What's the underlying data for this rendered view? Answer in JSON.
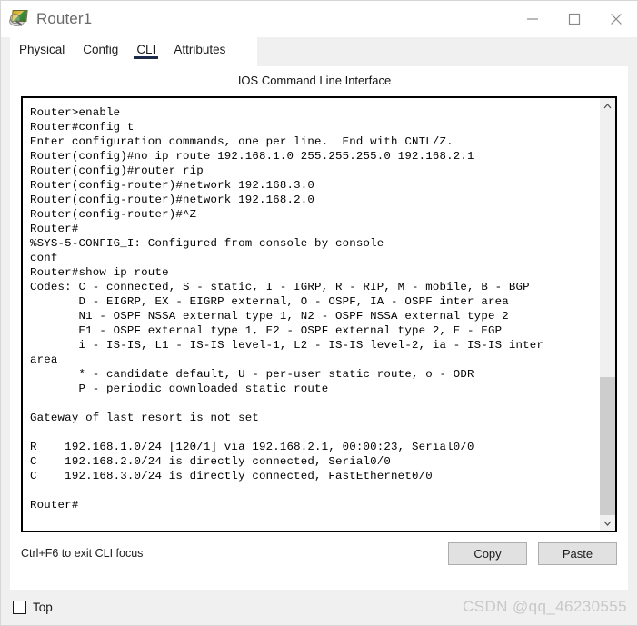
{
  "window": {
    "title": "Router1",
    "icon": "packet-tracer-router-icon",
    "controls": {
      "minimize": "minimize-icon",
      "maximize": "maximize-icon",
      "close": "close-icon"
    }
  },
  "tabs": [
    {
      "label": "Physical",
      "active": false
    },
    {
      "label": "Config",
      "active": false
    },
    {
      "label": "CLI",
      "active": true
    },
    {
      "label": "Attributes",
      "active": false
    }
  ],
  "panel": {
    "heading": "IOS Command Line Interface"
  },
  "console": {
    "text": "Router>enable\nRouter#config t\nEnter configuration commands, one per line.  End with CNTL/Z.\nRouter(config)#no ip route 192.168.1.0 255.255.255.0 192.168.2.1\nRouter(config)#router rip\nRouter(config-router)#network 192.168.3.0\nRouter(config-router)#network 192.168.2.0\nRouter(config-router)#^Z\nRouter#\n%SYS-5-CONFIG_I: Configured from console by console\nconf\nRouter#show ip route\nCodes: C - connected, S - static, I - IGRP, R - RIP, M - mobile, B - BGP\n       D - EIGRP, EX - EIGRP external, O - OSPF, IA - OSPF inter area\n       N1 - OSPF NSSA external type 1, N2 - OSPF NSSA external type 2\n       E1 - OSPF external type 1, E2 - OSPF external type 2, E - EGP\n       i - IS-IS, L1 - IS-IS level-1, L2 - IS-IS level-2, ia - IS-IS inter\narea\n       * - candidate default, U - per-user static route, o - ODR\n       P - periodic downloaded static route\n\nGateway of last resort is not set\n\nR    192.168.1.0/24 [120/1] via 192.168.2.1, 00:00:23, Serial0/0\nC    192.168.2.0/24 is directly connected, Serial0/0\nC    192.168.3.0/24 is directly connected, FastEthernet0/0\n\nRouter#",
    "scrollbar": {
      "up_arrow": "chevron-up-icon",
      "down_arrow": "chevron-down-icon"
    }
  },
  "footer": {
    "hint": "Ctrl+F6 to exit CLI focus",
    "copy_label": "Copy",
    "paste_label": "Paste"
  },
  "bottom": {
    "top_checkbox_label": "Top",
    "top_checked": false,
    "watermark": "CSDN @qq_46230555"
  },
  "colors": {
    "accent": "#1b2a49",
    "window_bg": "#f0f0f0",
    "panel_bg": "#ffffff",
    "button_bg": "#e1e1e1",
    "scrollbar_thumb": "#cdcdcd",
    "watermark": "#c8c8c8"
  }
}
